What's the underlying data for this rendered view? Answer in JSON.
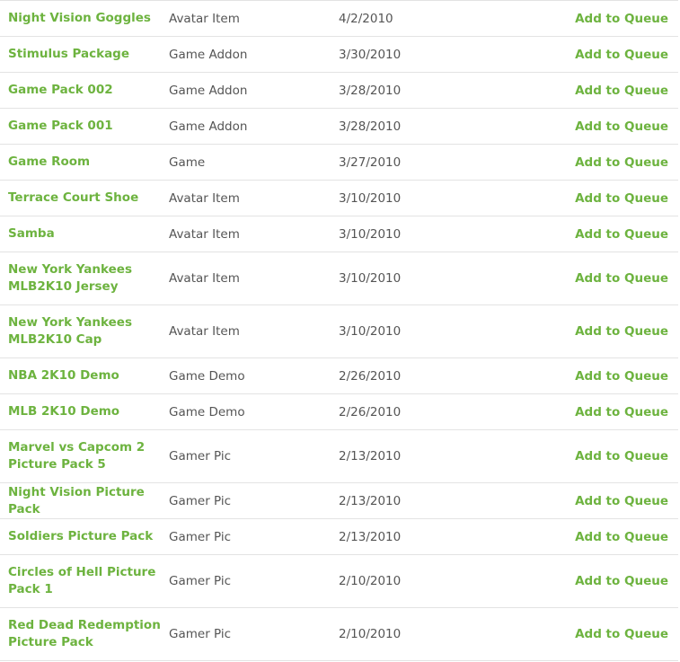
{
  "colors": {
    "link_green": "#6db33f",
    "text_gray": "#555555",
    "divider": "#e3e3e3"
  },
  "table": {
    "rows": [
      {
        "name": "Night Vision Goggles",
        "type": "Avatar Item",
        "date": "4/2/2010",
        "action": "Add to Queue"
      },
      {
        "name": "Stimulus Package",
        "type": "Game Addon",
        "date": "3/30/2010",
        "action": "Add to Queue"
      },
      {
        "name": "Game Pack 002",
        "type": "Game Addon",
        "date": "3/28/2010",
        "action": "Add to Queue"
      },
      {
        "name": "Game Pack 001",
        "type": "Game Addon",
        "date": "3/28/2010",
        "action": "Add to Queue"
      },
      {
        "name": "Game Room",
        "type": "Game",
        "date": "3/27/2010",
        "action": "Add to Queue"
      },
      {
        "name": "Terrace Court Shoe",
        "type": "Avatar Item",
        "date": "3/10/2010",
        "action": "Add to Queue"
      },
      {
        "name": "Samba",
        "type": "Avatar Item",
        "date": "3/10/2010",
        "action": "Add to Queue"
      },
      {
        "name": "New York Yankees MLB2K10 Jersey",
        "type": "Avatar Item",
        "date": "3/10/2010",
        "action": "Add to Queue"
      },
      {
        "name": "New York Yankees MLB2K10 Cap",
        "type": "Avatar Item",
        "date": "3/10/2010",
        "action": "Add to Queue"
      },
      {
        "name": "NBA 2K10 Demo",
        "type": "Game Demo",
        "date": "2/26/2010",
        "action": "Add to Queue"
      },
      {
        "name": "MLB 2K10 Demo",
        "type": "Game Demo",
        "date": "2/26/2010",
        "action": "Add to Queue"
      },
      {
        "name": "Marvel vs Capcom 2 Picture Pack 5",
        "type": "Gamer Pic",
        "date": "2/13/2010",
        "action": "Add to Queue"
      },
      {
        "name": "Night Vision Picture Pack",
        "type": "Gamer Pic",
        "date": "2/13/2010",
        "action": "Add to Queue"
      },
      {
        "name": "Soldiers Picture Pack",
        "type": "Gamer Pic",
        "date": "2/13/2010",
        "action": "Add to Queue"
      },
      {
        "name": "Circles of Hell Picture Pack 1",
        "type": "Gamer Pic",
        "date": "2/10/2010",
        "action": "Add to Queue"
      },
      {
        "name": "Red Dead Redemption Picture Pack",
        "type": "Gamer Pic",
        "date": "2/10/2010",
        "action": "Add to Queue"
      }
    ]
  }
}
